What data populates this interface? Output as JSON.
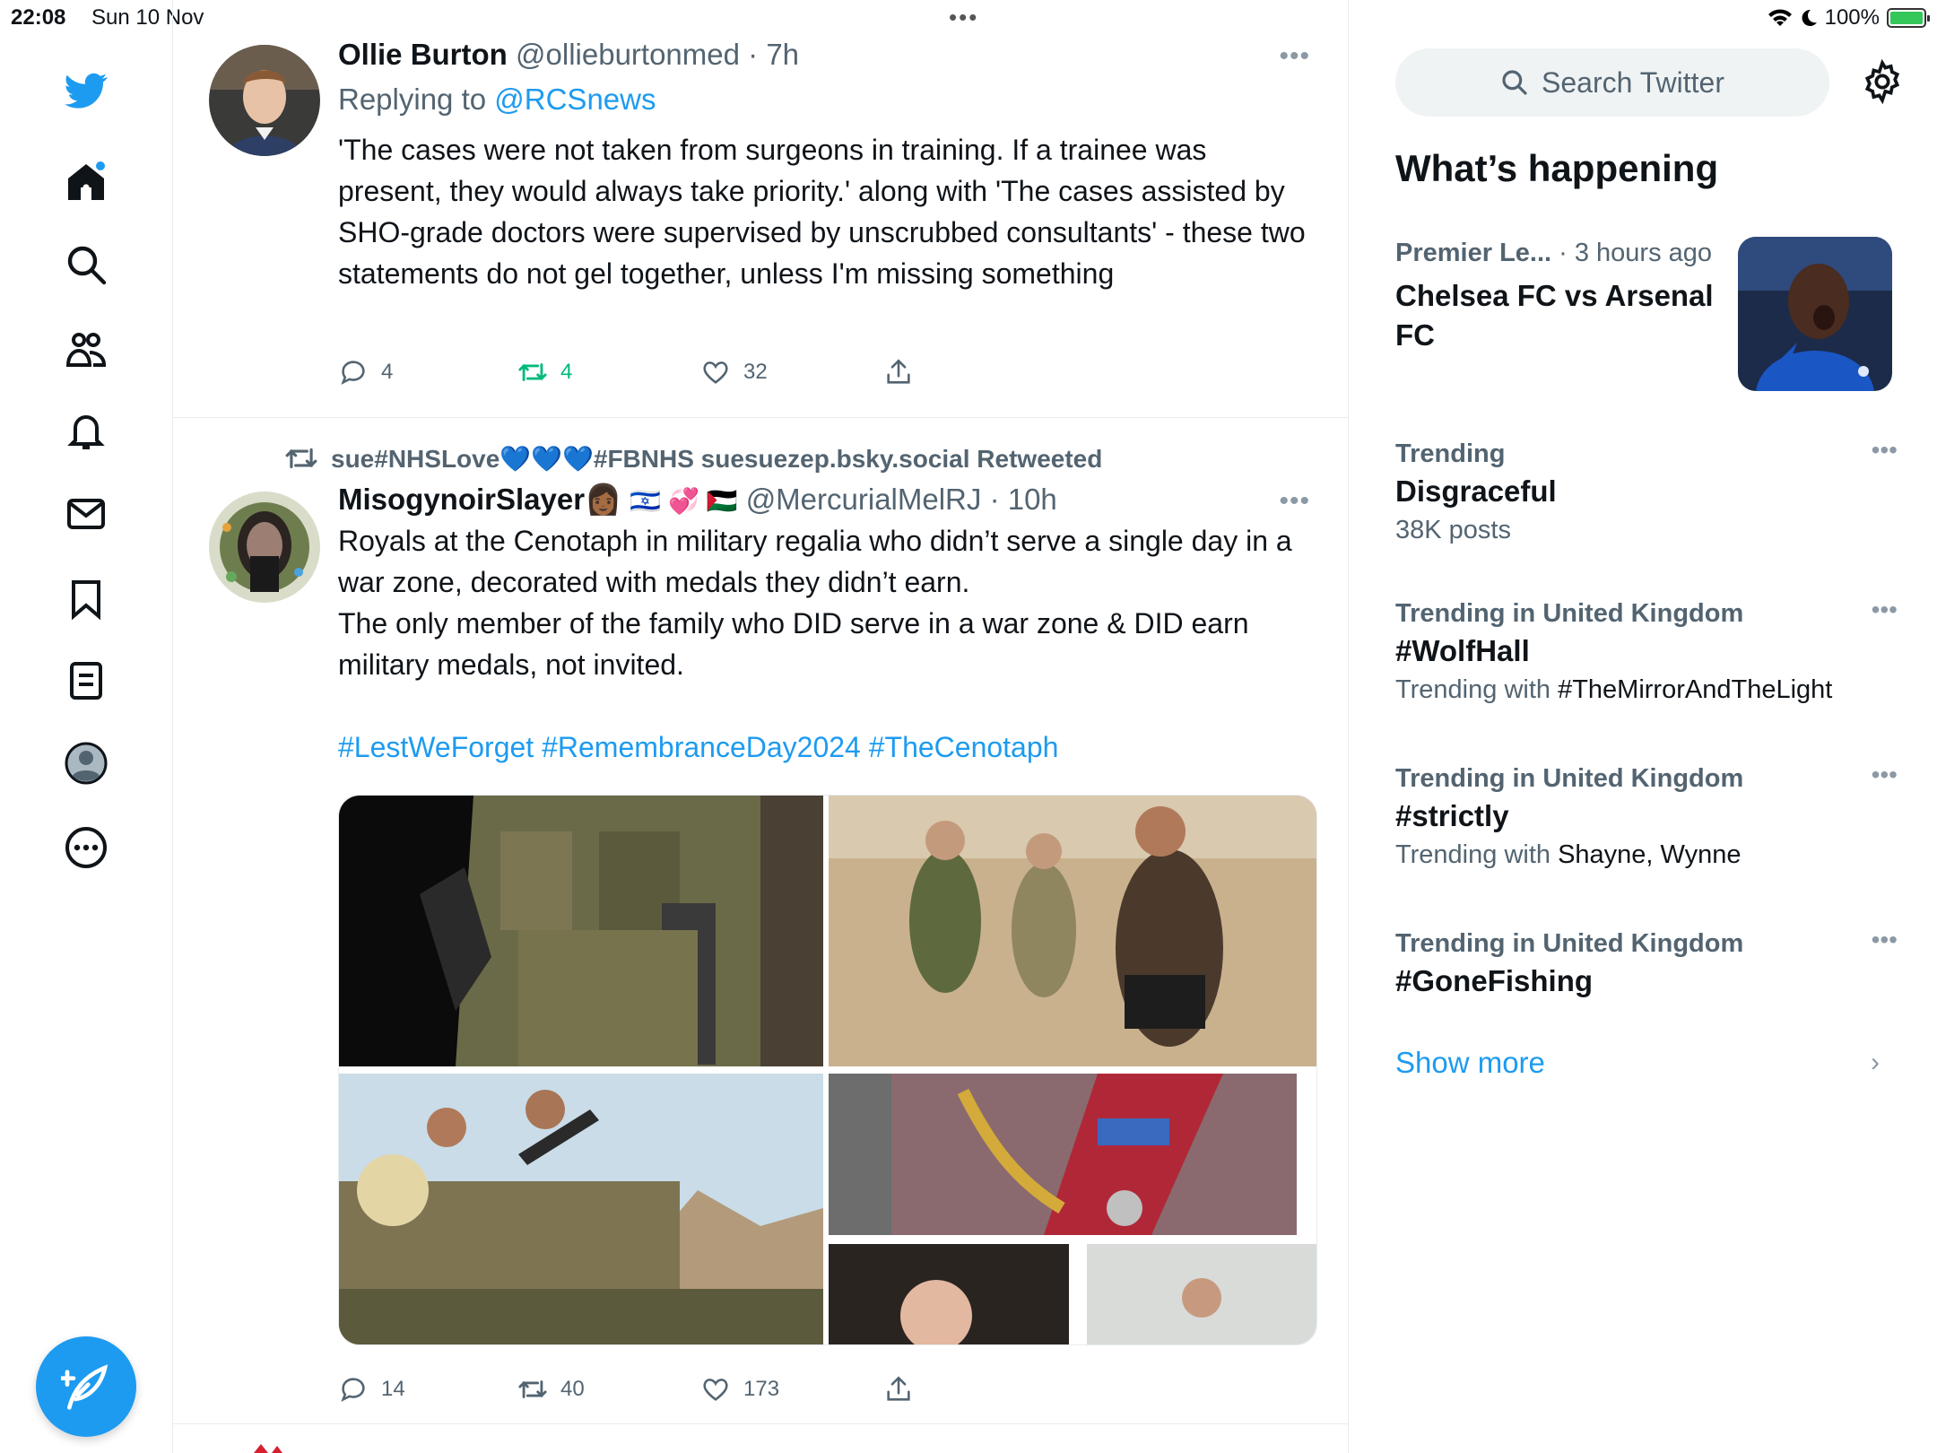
{
  "status_bar": {
    "time": "22:08",
    "date": "Sun 10 Nov",
    "battery": "100%"
  },
  "nav": {
    "items": [
      "twitter-logo",
      "home",
      "explore",
      "communities",
      "notifications",
      "messages",
      "bookmarks",
      "lists",
      "profile",
      "more"
    ],
    "compose_label": ""
  },
  "timeline": {
    "tweet1": {
      "name": "Ollie Burton",
      "handle": "@ollieburtonmed",
      "time": "· 7h",
      "replying_prefix": "Replying to ",
      "replying_to": "@RCSnews",
      "text": "'The cases were not taken from surgeons in training. If a trainee was present, they would always take priority.' along with 'The cases assisted by SHO-grade doctors were supervised by unscrubbed consultants' - these two statements do not gel together, unless I'm missing something",
      "replies": "4",
      "retweets": "4",
      "likes": "32"
    },
    "tweet2": {
      "retweeted_by": "sue#NHSLove💙💙💙#FBNHS suesuezep.bsky.social Retweeted",
      "name": "MisogynoirSlayer👩🏾",
      "flags": "🇮🇱 💞 🇵🇸",
      "handle": "@MercurialMelRJ",
      "time": "· 10h",
      "text": "Royals at the Cenotaph in military regalia who didn’t serve a single day in a war zone, decorated with medals they didn’t earn.\nThe only member of the family who DID serve in a war zone & DID earn military medals, not invited.",
      "hashtags": "#LestWeForget #RemembranceDay2024 #TheCenotaph",
      "replies": "14",
      "retweets": "40",
      "likes": "173"
    }
  },
  "sidebar": {
    "search_placeholder": "Search Twitter",
    "whats_happening": "What’s happening",
    "trends": [
      {
        "category": "Premier Le...",
        "meta": " · 3 hours ago",
        "title": "Chelsea FC vs Arsenal FC",
        "sub": ""
      },
      {
        "category": "Trending",
        "meta": "",
        "title": "Disgraceful",
        "sub": "38K posts"
      },
      {
        "category": "Trending in United Kingdom",
        "meta": "",
        "title": "#WolfHall",
        "sub_prefix": "Trending with ",
        "sub_dark": "#TheMirrorAndTheLight"
      },
      {
        "category": "Trending in United Kingdom",
        "meta": "",
        "title": "#strictly",
        "sub_prefix": "Trending with ",
        "sub_dark": "Shayne, Wynne"
      },
      {
        "category": "Trending in United Kingdom",
        "meta": "",
        "title": "#GoneFishing",
        "sub": ""
      }
    ],
    "show_more": "Show more"
  },
  "colors": {
    "accent": "#1d9bf0",
    "retweet_green": "#00ba7c",
    "muted": "#536471"
  }
}
